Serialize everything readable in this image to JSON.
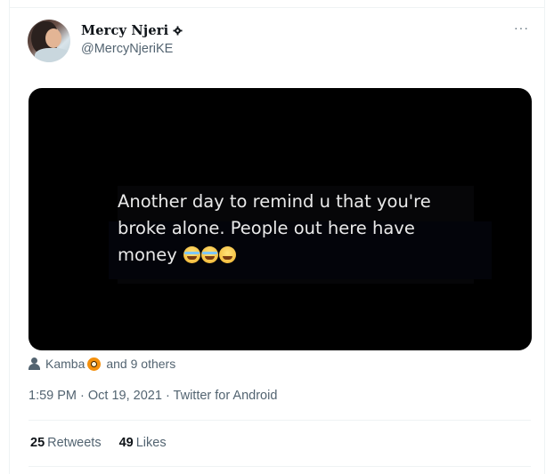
{
  "tweet": {
    "author_name": "Mercy Njeri",
    "author_handle": "@MercyNjeriKE",
    "more_label": "···",
    "media_text": "Another day  to remind u that you're broke alone. People out here have money",
    "liked_by_name": "Kamba",
    "liked_by_rest": "and 9 others",
    "timestamp": "1:59 PM · Oct 19, 2021 · Twitter for Android",
    "retweets_count": "25",
    "retweets_label": "Retweets",
    "likes_count": "49",
    "likes_label": "Likes"
  },
  "icons": {
    "verified": "gear-badge-icon",
    "more": "more-options-icon",
    "liked_by": "person-icon",
    "emoji_in_name": "radioactive-emoji-icon",
    "media_emojis": [
      "tears-of-joy-emoji",
      "tears-of-joy-emoji",
      "weary-emoji"
    ]
  },
  "colors": {
    "text_primary": "#0f1419",
    "text_secondary": "#536471",
    "media_background": "#000000",
    "divider": "#eff3f4"
  }
}
